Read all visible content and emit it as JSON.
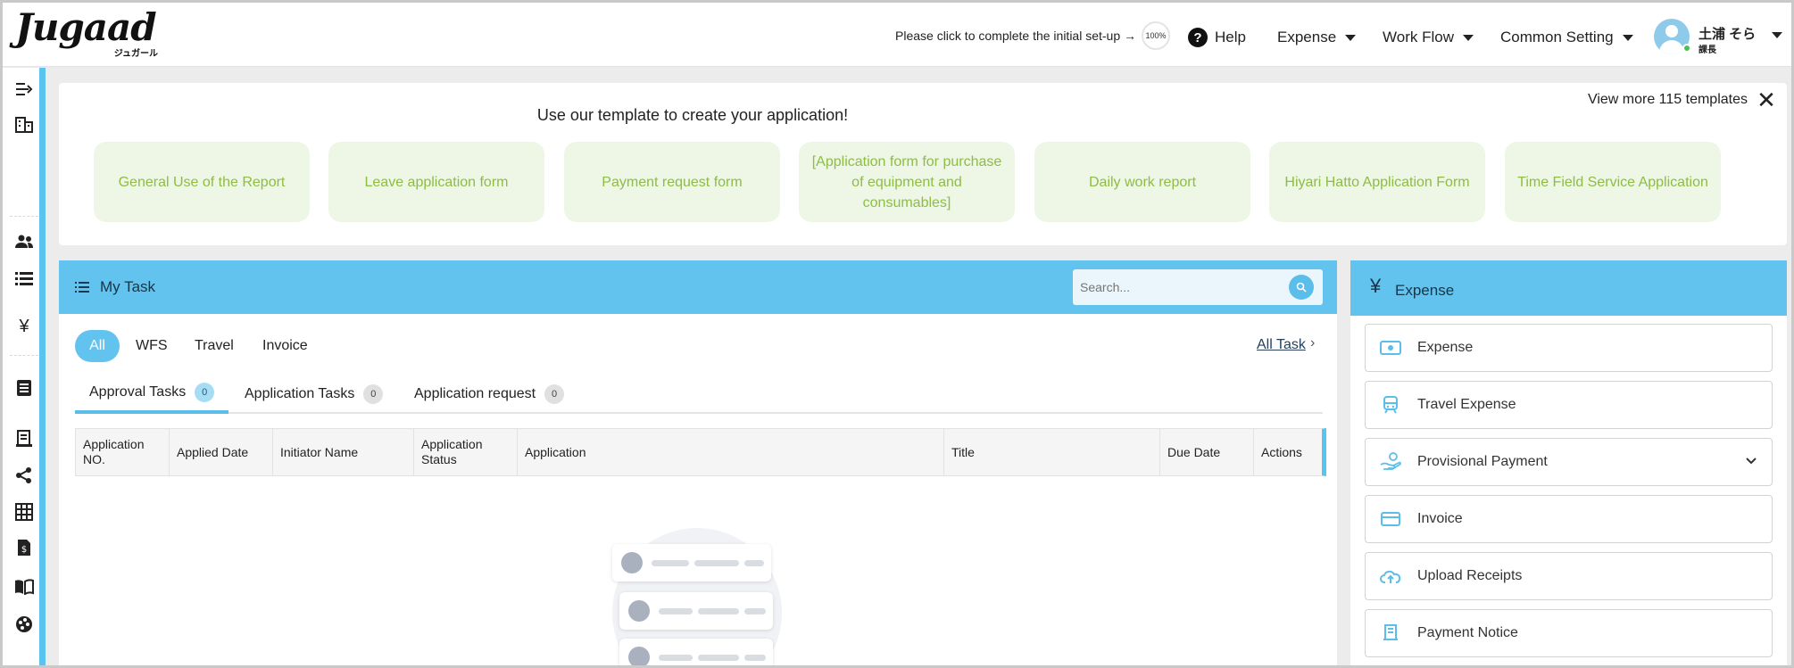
{
  "header": {
    "logo_text": "Jugaad",
    "logo_sub": "ジュガール",
    "setup_text": "Please click to complete the initial set-up →",
    "setup_progress": "100%",
    "help": "Help",
    "nav": [
      "Expense",
      "Work Flow",
      "Common Setting"
    ],
    "user_name": "土浦 そら",
    "user_role": "課長"
  },
  "templates": {
    "title": "Use our template to create your application!",
    "view_more": "View more 115 templates",
    "close": "✕",
    "cards": [
      "General Use of the Report",
      "Leave application form",
      "Payment request form",
      "[Application form for purchase of equipment and consumables]",
      "Daily work report",
      "Hiyari Hatto Application Form",
      "Time Field Service Application"
    ]
  },
  "task": {
    "title": "My Task",
    "search_placeholder": "Search...",
    "filters": [
      "All",
      "WFS",
      "Travel",
      "Invoice"
    ],
    "all_task": "All Task",
    "subtabs": [
      {
        "label": "Approval Tasks",
        "count": "0"
      },
      {
        "label": "Application Tasks",
        "count": "0"
      },
      {
        "label": "Application request",
        "count": "0"
      }
    ],
    "columns": [
      "Application NO.",
      "Applied Date",
      "Initiator Name",
      "Application Status",
      "Application",
      "Title",
      "Due Date",
      "Actions"
    ]
  },
  "expense": {
    "title": "Expense",
    "items": [
      {
        "label": "Expense",
        "icon": "money-icon"
      },
      {
        "label": "Travel Expense",
        "icon": "train-icon"
      },
      {
        "label": "Provisional Payment",
        "icon": "hand-coins-icon"
      },
      {
        "label": "Invoice",
        "icon": "card-icon"
      },
      {
        "label": "Upload Receipts",
        "icon": "cloud-upload-icon"
      },
      {
        "label": "Payment Notice",
        "icon": "receipt-icon"
      }
    ]
  },
  "colors": {
    "accent": "#62c4ee",
    "template_card_bg": "#eef6e6",
    "template_card_text": "#8dbd43"
  }
}
